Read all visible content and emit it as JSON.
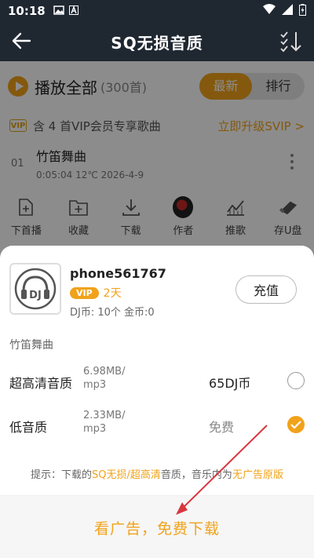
{
  "status": {
    "time": "10:18",
    "icons": [
      "image-icon",
      "app-a-icon",
      "wifi-icon",
      "signal-icon",
      "battery-icon"
    ]
  },
  "header": {
    "title": "SQ无损音质"
  },
  "playlist": {
    "play_all": "播放全部",
    "count": "(300首)",
    "tabs": [
      "最新",
      "排行"
    ],
    "active_tab": "最新",
    "vip_note": "含 4 首VIP会员专享歌曲",
    "upgrade": "立即升级SVIP >",
    "song": {
      "index": "01",
      "title": "竹笛舞曲",
      "meta": "0:05:04   12℃   2026-4-9"
    }
  },
  "actions": [
    "下首播",
    "收藏",
    "下载",
    "作者",
    "推歌",
    "存U盘"
  ],
  "sheet": {
    "user": {
      "name": "phone561767",
      "vip_badge": "VIP",
      "vip_days": "2天",
      "coins": "DJ币: 10个   金币:0",
      "recharge": "充值",
      "logo_text": "DJ"
    },
    "song_title": "竹笛舞曲",
    "qualities": [
      {
        "name": "超高清音质",
        "size_line1": "6.98MB/",
        "size_line2": "mp3",
        "price": "65DJ币",
        "selected": false
      },
      {
        "name": "低音质",
        "size_line1": "2.33MB/",
        "size_line2": "mp3",
        "price": "免费",
        "selected": true
      }
    ],
    "tip": {
      "prefix": "提示：下载的",
      "hl1": "SQ无损/超高清",
      "middle": "音质，音乐内为",
      "hl2": "无广告原版"
    },
    "cta": "看广告，免费下载"
  },
  "colors": {
    "accent": "#f1a21a",
    "header_bg": "#1f2731",
    "annotation_arrow": "#d9363e"
  }
}
